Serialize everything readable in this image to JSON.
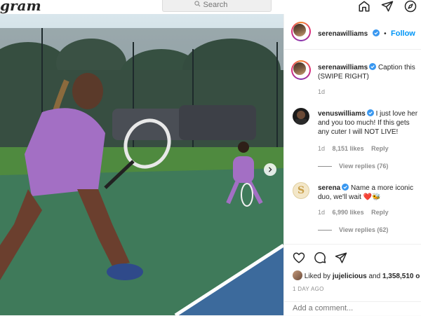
{
  "topbar": {
    "logo_text": "gram",
    "search_placeholder": "Search"
  },
  "post": {
    "header": {
      "username": "serenawilliams",
      "separator": "•",
      "follow_label": "Follow"
    },
    "caption": {
      "username": "serenawilliams",
      "text": "Caption this (SWIPE RIGHT)",
      "time": "1d"
    },
    "comments": [
      {
        "username": "venuswilliams",
        "text": "I just love her and you too much! If this gets any cuter I will NOT LIVE!",
        "time": "1d",
        "likes": "8,151 likes",
        "reply_label": "Reply",
        "view_replies": "View replies (76)"
      },
      {
        "username": "serena",
        "text": "Name a more iconic duo, we'll wait",
        "emoji": "❤️🐝",
        "time": "1d",
        "likes": "6,990 likes",
        "reply_label": "Reply",
        "view_replies": "View replies (62)"
      }
    ],
    "liked_by": {
      "prefix": "Liked by",
      "user": "jujelicious",
      "middle": "and",
      "count": "1,358,510",
      "suffix": "o"
    },
    "timestamp": "1 DAY AGO",
    "add_comment_placeholder": "Add a comment..."
  },
  "colors": {
    "accent": "#0095f6",
    "verified": "#3897f0",
    "court_green": "#3f7a5a",
    "court_blue": "#3c6a9c",
    "outfit": "#a36fc4"
  },
  "icons": [
    "search-icon",
    "home-icon",
    "direct-icon",
    "explore-icon",
    "verified-icon",
    "next-arrow-icon",
    "heart-icon",
    "comment-icon",
    "share-icon"
  ]
}
